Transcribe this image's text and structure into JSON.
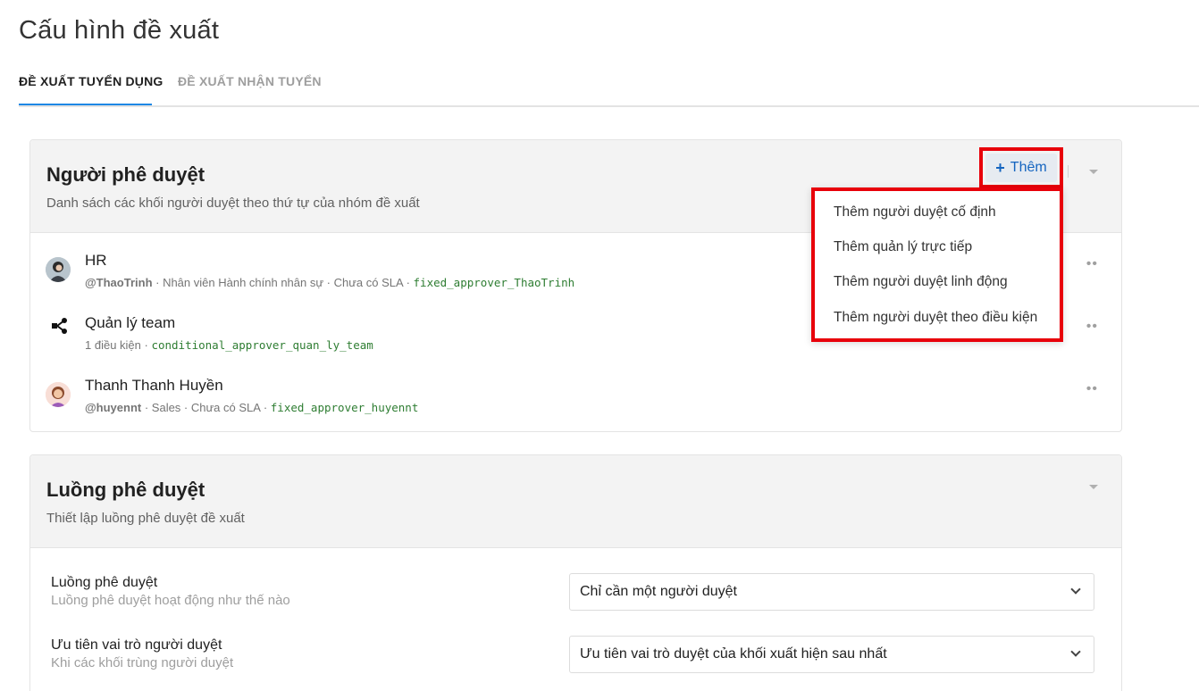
{
  "page": {
    "title": "Cấu hình đề xuất"
  },
  "tabs": [
    {
      "label": "ĐỀ XUẤT TUYỂN DỤNG",
      "active": true
    },
    {
      "label": "ĐỀ XUẤT NHẬN TUYỂN",
      "active": false
    }
  ],
  "approvers": {
    "title": "Người phê duyệt",
    "subtitle": "Danh sách các khối người duyệt theo thứ tự của nhóm đề xuất",
    "add_label": "Thêm",
    "items": [
      {
        "name": "HR",
        "handle": "@ThaoTrinh",
        "meta": " · Nhân viên Hành chính nhân sự · Chưa có SLA · ",
        "code": "fixed_approver_ThaoTrinh",
        "icon": "user-avatar"
      },
      {
        "name": "Quản lý team",
        "handle": "",
        "meta": "1 điều kiện · ",
        "code": "conditional_approver_quan_ly_team",
        "icon": "flow-branch-icon"
      },
      {
        "name": "Thanh Thanh Huyền",
        "handle": "@huyennt",
        "meta": " · Sales · Chưa có SLA · ",
        "code": "fixed_approver_huyennt",
        "icon": "user-avatar"
      }
    ]
  },
  "add_menu": {
    "items": [
      "Thêm người duyệt cố định",
      "Thêm quản lý trực tiếp",
      "Thêm người duyệt linh động",
      "Thêm người duyệt theo điều kiện"
    ]
  },
  "flow": {
    "title": "Luồng phê duyệt",
    "subtitle": "Thiết lập luồng phê duyệt đề xuất",
    "settings": [
      {
        "label": "Luồng phê duyệt",
        "help": "Luồng phê duyệt hoạt động như thế nào",
        "value": "Chỉ cần một người duyệt"
      },
      {
        "label": "Ưu tiên vai trò người duyệt",
        "help": "Khi các khối trùng người duyệt",
        "value": "Ưu tiên vai trò duyệt của khối xuất hiện sau nhất"
      }
    ]
  },
  "colors": {
    "accent": "#1565c0",
    "highlight": "#e8000a",
    "code": "#2e7d32"
  }
}
